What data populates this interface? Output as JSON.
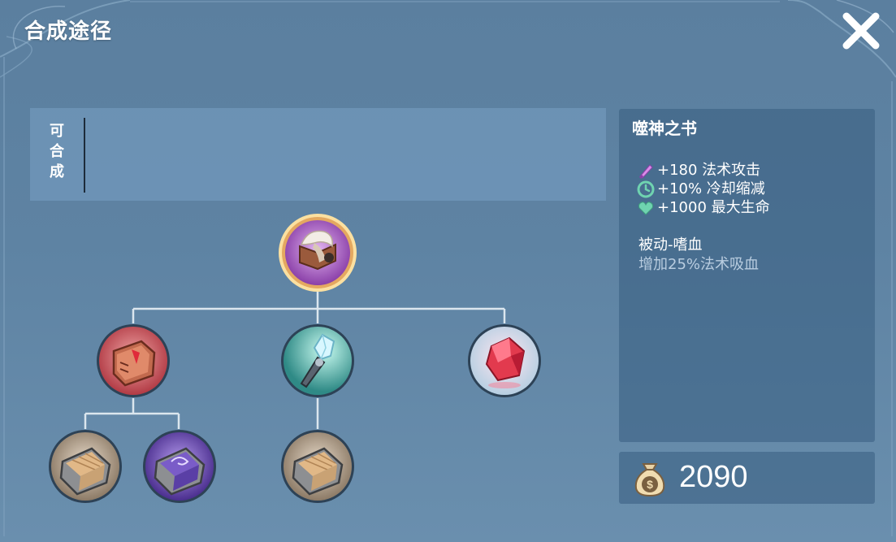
{
  "header": {
    "title": "合成途径",
    "close_icon": "close-icon"
  },
  "craftable": {
    "label_chars": [
      "可",
      "合",
      "成"
    ]
  },
  "tree": {
    "root": {
      "name": "噬神之书",
      "icon": "tome-with-mask-icon"
    },
    "components": [
      {
        "icon": "red-spellbook-icon",
        "subcomponents": [
          {
            "icon": "wooden-tome-icon"
          },
          {
            "icon": "purple-tome-icon"
          }
        ]
      },
      {
        "icon": "crystal-wand-icon",
        "subcomponents": [
          {
            "icon": "wooden-tome-icon"
          }
        ]
      },
      {
        "icon": "red-gem-icon",
        "subcomponents": []
      }
    ]
  },
  "item": {
    "name": "噬神之书",
    "stats": [
      {
        "icon": "magic-attack-icon",
        "text": "+180 法术攻击"
      },
      {
        "icon": "cooldown-icon",
        "text": "+10% 冷却缩减"
      },
      {
        "icon": "max-hp-icon",
        "text": "+1000 最大生命"
      }
    ],
    "passive_title": "被动-嗜血",
    "passive_desc": "增加25%法术吸血"
  },
  "price": {
    "value": "2090",
    "icon": "money-bag-icon"
  },
  "colors": {
    "panel": "#4c7396",
    "connector": "#dbe6ee",
    "gold_ring": "#f1c77a"
  }
}
